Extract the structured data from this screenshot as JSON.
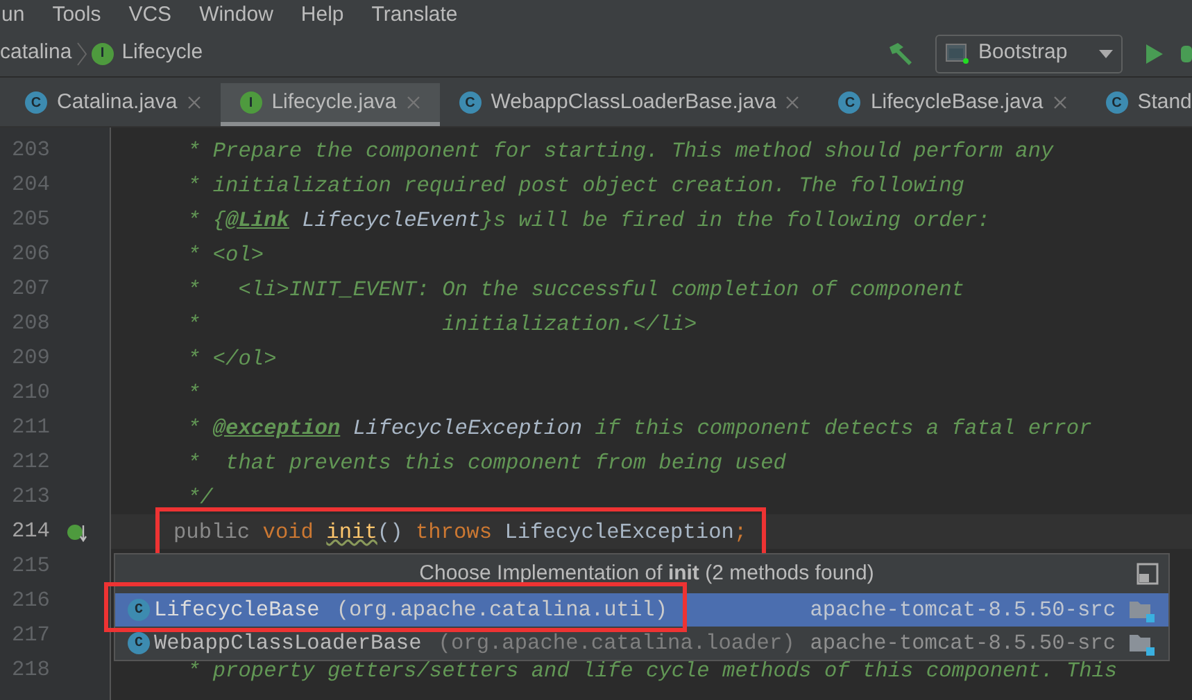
{
  "menu": [
    "un",
    "Tools",
    "VCS",
    "Window",
    "Help",
    "Translate"
  ],
  "breadcrumb": [
    {
      "label": "catalina",
      "kind": "package"
    },
    {
      "label": "Lifecycle",
      "kind": "interface",
      "badge": "I"
    }
  ],
  "run_config": {
    "label": "Bootstrap"
  },
  "tabs": [
    {
      "label": "Catalina.java",
      "kind": "class",
      "badge": "C",
      "selected": false,
      "closable": true
    },
    {
      "label": "Lifecycle.java",
      "kind": "interface",
      "badge": "I",
      "selected": true,
      "closable": true
    },
    {
      "label": "WebappClassLoaderBase.java",
      "kind": "abstract",
      "badge": "C",
      "selected": false,
      "closable": true
    },
    {
      "label": "LifecycleBase.java",
      "kind": "abstract",
      "badge": "C",
      "selected": false,
      "closable": true
    },
    {
      "label": "Stand",
      "kind": "class",
      "badge": "C",
      "selected": false,
      "closable": false
    }
  ],
  "editor": {
    "lines": [
      {
        "number": "203",
        "current": false,
        "segments": [
          {
            "kind": "comment",
            "text": "* Prepare the component for starting. This method should perform any"
          }
        ]
      },
      {
        "number": "204",
        "current": false,
        "segments": [
          {
            "kind": "comment",
            "text": "* initialization required post object creation. The following"
          }
        ]
      },
      {
        "number": "205",
        "current": false,
        "segments": [
          {
            "kind": "comment",
            "text": "* {"
          },
          {
            "kind": "doctag",
            "text": "@Link"
          },
          {
            "kind": "docref",
            "text": " LifecycleEvent"
          },
          {
            "kind": "comment",
            "text": "}s will be fired in the following order:"
          }
        ]
      },
      {
        "number": "206",
        "current": false,
        "segments": [
          {
            "kind": "comment",
            "text": "* <ol>"
          }
        ]
      },
      {
        "number": "207",
        "current": false,
        "segments": [
          {
            "kind": "comment",
            "text": "*   <li>INIT_EVENT: On the successful completion of component"
          }
        ]
      },
      {
        "number": "208",
        "current": false,
        "segments": [
          {
            "kind": "comment",
            "text": "*                   initialization.</li>"
          }
        ]
      },
      {
        "number": "209",
        "current": false,
        "segments": [
          {
            "kind": "comment",
            "text": "* </ol>"
          }
        ]
      },
      {
        "number": "210",
        "current": false,
        "segments": [
          {
            "kind": "comment",
            "text": "*"
          }
        ]
      },
      {
        "number": "211",
        "current": false,
        "segments": [
          {
            "kind": "comment",
            "text": "* "
          },
          {
            "kind": "doctag",
            "text": "@exception"
          },
          {
            "kind": "docref",
            "text": " LifecycleException"
          },
          {
            "kind": "comment",
            "text": " if this component detects a fatal error"
          }
        ]
      },
      {
        "number": "212",
        "current": false,
        "segments": [
          {
            "kind": "comment",
            "text": "*  that prevents this component from being used"
          }
        ]
      },
      {
        "number": "213",
        "current": false,
        "segments": [
          {
            "kind": "comment",
            "text": "*/"
          }
        ]
      },
      {
        "number": "214",
        "current": true,
        "segments": [
          {
            "kind": "modifier",
            "text": "public "
          },
          {
            "kind": "keyword",
            "text": "void "
          },
          {
            "kind": "method",
            "text": "init"
          },
          {
            "kind": "plain",
            "text": "() "
          },
          {
            "kind": "keyword",
            "text": "throws "
          },
          {
            "kind": "plain",
            "text": "LifecycleException"
          },
          {
            "kind": "keyword",
            "text": ";"
          }
        ]
      },
      {
        "number": "215",
        "current": false
      },
      {
        "number": "216",
        "current": false
      },
      {
        "number": "217",
        "current": false
      },
      {
        "number": "218",
        "current": false,
        "segments": [
          {
            "kind": "comment",
            "text": "* property getters/setters and life cycle methods of this component. This"
          }
        ]
      }
    ]
  },
  "popup": {
    "title": "Choose Implementation of **init** (2 methods found)",
    "items": [
      {
        "badge": "C",
        "name": "LifecycleBase",
        "package": "(org.apache.catalina.util)",
        "module": "apache-tomcat-8.5.50-src",
        "selected": true
      },
      {
        "badge": "C",
        "name": "WebappClassLoaderBase",
        "package": "(org.apache.catalina.loader)",
        "module": "apache-tomcat-8.5.50-src",
        "selected": false
      }
    ]
  }
}
